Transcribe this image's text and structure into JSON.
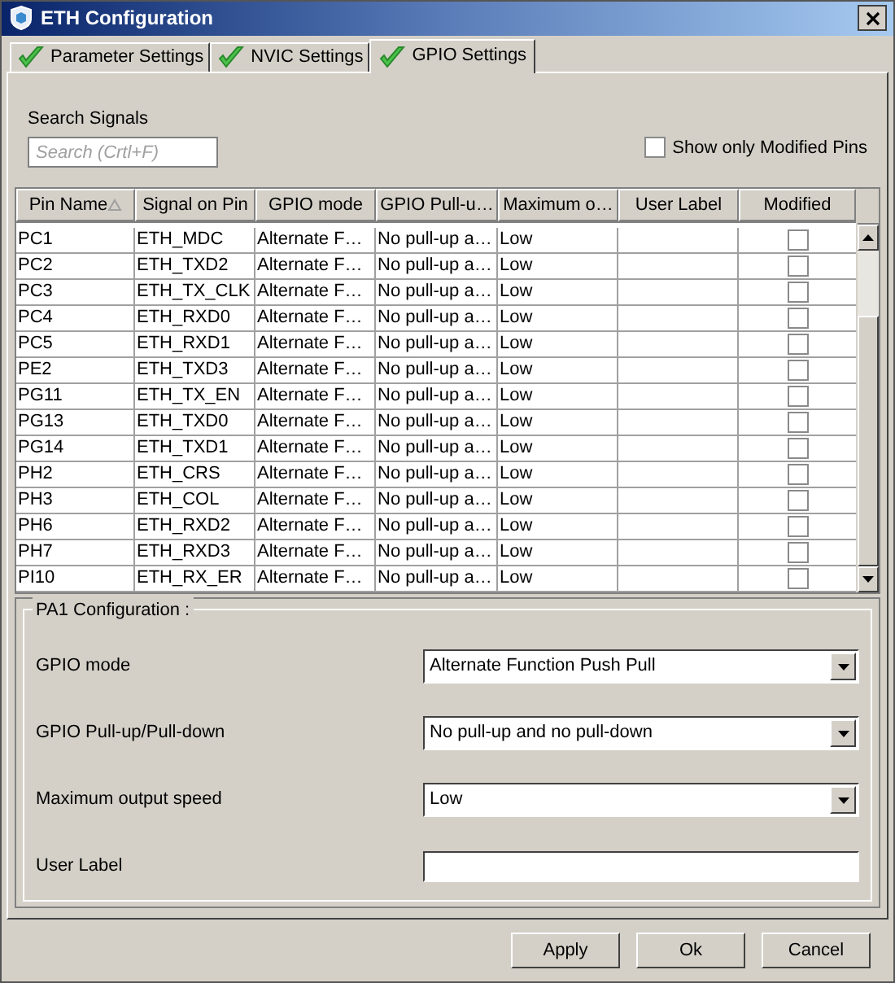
{
  "window": {
    "title": "ETH Configuration"
  },
  "tabs": [
    {
      "label": "Parameter Settings",
      "selected": false
    },
    {
      "label": "NVIC Settings",
      "selected": false
    },
    {
      "label": "GPIO Settings",
      "selected": true
    }
  ],
  "search": {
    "label": "Search Signals",
    "placeholder": "Search (Crtl+F)"
  },
  "show_only_modified": {
    "label": "Show only Modified Pins",
    "checked": false
  },
  "table": {
    "columns": [
      "Pin Name",
      "Signal on Pin",
      "GPIO mode",
      "GPIO Pull-u…",
      "Maximum o…",
      "User Label",
      "Modified"
    ],
    "rows": [
      {
        "pin": "PC1",
        "signal": "ETH_MDC",
        "mode": "Alternate F…",
        "pull": "No pull-up a…",
        "speed": "Low",
        "modified": false
      },
      {
        "pin": "PC2",
        "signal": "ETH_TXD2",
        "mode": "Alternate F…",
        "pull": "No pull-up a…",
        "speed": "Low",
        "modified": false
      },
      {
        "pin": "PC3",
        "signal": "ETH_TX_CLK",
        "mode": "Alternate F…",
        "pull": "No pull-up a…",
        "speed": "Low",
        "modified": false
      },
      {
        "pin": "PC4",
        "signal": "ETH_RXD0",
        "mode": "Alternate F…",
        "pull": "No pull-up a…",
        "speed": "Low",
        "modified": false
      },
      {
        "pin": "PC5",
        "signal": "ETH_RXD1",
        "mode": "Alternate F…",
        "pull": "No pull-up a…",
        "speed": "Low",
        "modified": false
      },
      {
        "pin": "PE2",
        "signal": "ETH_TXD3",
        "mode": "Alternate F…",
        "pull": "No pull-up a…",
        "speed": "Low",
        "modified": false
      },
      {
        "pin": "PG11",
        "signal": "ETH_TX_EN",
        "mode": "Alternate F…",
        "pull": "No pull-up a…",
        "speed": "Low",
        "modified": false
      },
      {
        "pin": "PG13",
        "signal": "ETH_TXD0",
        "mode": "Alternate F…",
        "pull": "No pull-up a…",
        "speed": "Low",
        "modified": false
      },
      {
        "pin": "PG14",
        "signal": "ETH_TXD1",
        "mode": "Alternate F…",
        "pull": "No pull-up a…",
        "speed": "Low",
        "modified": false
      },
      {
        "pin": "PH2",
        "signal": "ETH_CRS",
        "mode": "Alternate F…",
        "pull": "No pull-up a…",
        "speed": "Low",
        "modified": false
      },
      {
        "pin": "PH3",
        "signal": "ETH_COL",
        "mode": "Alternate F…",
        "pull": "No pull-up a…",
        "speed": "Low",
        "modified": false
      },
      {
        "pin": "PH6",
        "signal": "ETH_RXD2",
        "mode": "Alternate F…",
        "pull": "No pull-up a…",
        "speed": "Low",
        "modified": false
      },
      {
        "pin": "PH7",
        "signal": "ETH_RXD3",
        "mode": "Alternate F…",
        "pull": "No pull-up a…",
        "speed": "Low",
        "modified": false
      },
      {
        "pin": "PI10",
        "signal": "ETH_RX_ER",
        "mode": "Alternate F…",
        "pull": "No pull-up a…",
        "speed": "Low",
        "modified": false
      }
    ]
  },
  "configuration": {
    "title": "PA1 Configuration :",
    "fields": [
      {
        "kind": "select",
        "label": "GPIO mode",
        "value": "Alternate Function Push Pull"
      },
      {
        "kind": "select",
        "label": "GPIO Pull-up/Pull-down",
        "value": "No pull-up and no pull-down"
      },
      {
        "kind": "select",
        "label": "Maximum output speed",
        "value": "Low"
      },
      {
        "kind": "text",
        "label": "User Label"
      }
    ]
  },
  "buttons": [
    "Apply",
    "Ok",
    "Cancel"
  ]
}
